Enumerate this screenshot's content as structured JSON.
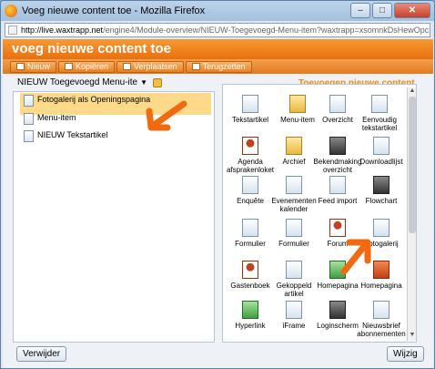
{
  "window": {
    "title": "Voeg nieuwe content toe - Mozilla Firefox"
  },
  "url": {
    "host": "http://live.waxtrapp.net",
    "path": "/engine4/Module-overview/NIEUW-Toegevoegd-Menu-item?waxtrapp=xsomnkDsHewOpcPEfBN&pane=gkbqxiDsHe"
  },
  "header": {
    "title": "voeg nieuwe content toe"
  },
  "toolbar": {
    "buttons": [
      "Nieuw",
      "Kopiëren",
      "Verplaatsen",
      "Terugzetten"
    ]
  },
  "left": {
    "dropdown_value": "NIEUW Toegevoegd Menu-ite",
    "items": [
      "Fotogalerij als Openingspagina",
      "Menu-item",
      "NIEUW Tekstartikel"
    ]
  },
  "right": {
    "title": "Toevoegen nieuwe content",
    "tiles": [
      "Tekstartikel",
      "Menu-item",
      "Overzicht",
      "Eenvoudig tekstartikel",
      "Agenda afsprakenloket",
      "Archief",
      "Bekendmaking overzicht",
      "Downloadlijst",
      "Enquête",
      "Evenementen kalender",
      "Feed import",
      "Flowchart",
      "Formulier",
      "Formulier",
      "Forum",
      "Fotogalerij",
      "Gastenboek",
      "Gekoppeld artikel",
      "Homepagina",
      "Homepagina",
      "Hyperlink",
      "iFrame",
      "Loginscherm",
      "Nieuwsbrief abonnementen"
    ]
  },
  "footer": {
    "delete_label": "Verwijder",
    "edit_label": "Wijzig"
  },
  "colors": {
    "accent": "#f07a10",
    "arrow": "#f26a10"
  }
}
